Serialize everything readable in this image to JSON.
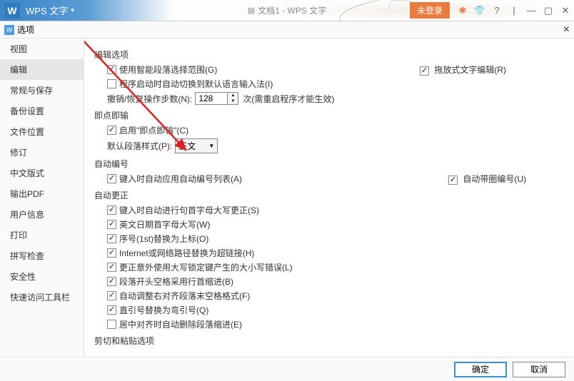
{
  "titlebar": {
    "app_logo": "W",
    "app_name": "WPS 文字",
    "doc_title": "文档1 - WPS 文字",
    "login": "未登录"
  },
  "dialog": {
    "title": "选项",
    "ok": "确定",
    "cancel": "取消"
  },
  "sidebar": {
    "items": [
      "视图",
      "编辑",
      "常规与保存",
      "备份设置",
      "文件位置",
      "修订",
      "中文版式",
      "输出PDF",
      "用户信息",
      "打印",
      "拼写检查",
      "安全性",
      "快速访问工具栏"
    ],
    "active_index": 1
  },
  "content": {
    "sections": {
      "edit_options": {
        "title": "编辑选项",
        "smart_select": "使用智能段落选择范围(G)",
        "drag_edit": "拖放式文字编辑(R)",
        "auto_ime": "程序启动时自动切换到默认语言输入法(I)",
        "undo_label": "撤销/恢复操作步数(N):",
        "undo_value": "128",
        "undo_suffix": "次(需重启程序才能生效)"
      },
      "instant_input": {
        "title": "即点即输",
        "enable": "启用\"即点即输\"(C)",
        "style_label": "默认段落样式(P):",
        "style_value": "正文"
      },
      "auto_number": {
        "title": "自动编号",
        "apply_list": "键入时自动应用自动编号列表(A)",
        "circled": "自动带圈编号(U)"
      },
      "auto_correct": {
        "title": "自动更正",
        "items": [
          "键入时自动进行句首字母大写更正(S)",
          "英文日期首字母大写(W)",
          "序号(1st)替换为上标(O)",
          "Internet或网络路径替换为超链接(H)",
          "更正意外使用大写锁定键产生的大小写错误(L)",
          "段落开头空格采用行首缩进(B)",
          "自动调整右对齐段落末空格格式(F)",
          "直引号替换为弯引号(Q)",
          "居中对齐时自动删除段落缩进(E)"
        ],
        "unchecked_indices": [
          8
        ]
      },
      "clipboard": {
        "title": "剪切和粘贴选项"
      }
    }
  }
}
